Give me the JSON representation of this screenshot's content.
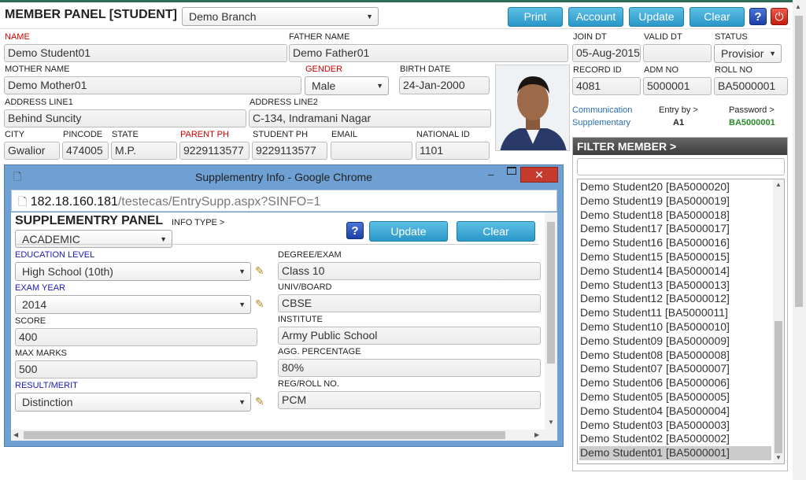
{
  "header": {
    "title": "MEMBER PANEL [STUDENT]",
    "branch": "Demo Branch",
    "buttons": [
      "Print",
      "Account",
      "Update",
      "Clear"
    ],
    "help": "?",
    "power": "⏻"
  },
  "form": {
    "name_label": "NAME",
    "name": "Demo Student01",
    "father_label": "FATHER NAME",
    "father": "Demo Father01",
    "join_label": "JOIN DT",
    "join": "05-Aug-2015",
    "valid_label": "VALID DT",
    "valid": "",
    "status_label": "STATUS",
    "status": "Provisior",
    "mother_label": "MOTHER NAME",
    "mother": "Demo Mother01",
    "gender_label": "GENDER",
    "gender": "Male",
    "birth_label": "BIRTH DATE",
    "birth": "24-Jan-2000",
    "record_label": "RECORD ID",
    "record": "4081",
    "adm_label": "ADM NO",
    "adm": "5000001",
    "roll_label": "ROLL NO",
    "roll": "BA5000001",
    "addr1_label": "ADDRESS LINE1",
    "addr1": "Behind Suncity",
    "addr2_label": "ADDRESS LINE2",
    "addr2": "C-134, Indramani Nagar",
    "comm": "Communication",
    "supp": "Supplementary",
    "entry_label": "Entry by >",
    "entry": "A1",
    "pass_label": "Password >",
    "pass": "BA5000001",
    "city_label": "CITY",
    "city": "Gwalior",
    "pin_label": "PINCODE",
    "pin": "474005",
    "state_label": "STATE",
    "state": "M.P.",
    "pph_label": "PARENT PH",
    "pph": "9229113577",
    "sph_label": "STUDENT PH",
    "sph": "9229113577",
    "email_label": "EMAIL",
    "email": "",
    "nid_label": "NATIONAL ID",
    "nid": "1101"
  },
  "popup": {
    "title": "Supplementry Info - Google Chrome",
    "url_host": "182.18.160.181",
    "url_path": "/testecas/EntrySupp.aspx?SINFO=1",
    "panel_title": "SUPPLEMENTRY PANEL",
    "info_type_label": "INFO TYPE >",
    "info_type": "ACADEMIC",
    "help": "?",
    "update": "Update",
    "clear": "Clear",
    "edu_label": "EDUCATION LEVEL",
    "edu": "High School (10th)",
    "degree_label": "DEGREE/EXAM",
    "degree": "Class 10",
    "exam_label": "EXAM YEAR",
    "exam": "2014",
    "univ_label": "UNIV/BOARD",
    "univ": "CBSE",
    "score_label": "SCORE",
    "score": "400",
    "inst_label": "INSTITUTE",
    "inst": "Army Public School",
    "max_label": "MAX MARKS",
    "max": "500",
    "agg_label": "AGG. PERCENTAGE",
    "agg": "80%",
    "result_label": "RESULT/MERIT",
    "result": "Distinction",
    "reg_label": "REG/ROLL NO.",
    "reg": "PCM"
  },
  "filter": {
    "title": "FILTER MEMBER >",
    "items": [
      "Demo Student20 [BA5000020]",
      "Demo Student19 [BA5000019]",
      "Demo Student18 [BA5000018]",
      "Demo Student17 [BA5000017]",
      "Demo Student16 [BA5000016]",
      "Demo Student15 [BA5000015]",
      "Demo Student14 [BA5000014]",
      "Demo Student13 [BA5000013]",
      "Demo Student12 [BA5000012]",
      "Demo Student11 [BA5000011]",
      "Demo Student10 [BA5000010]",
      "Demo Student09 [BA5000009]",
      "Demo Student08 [BA5000008]",
      "Demo Student07 [BA5000007]",
      "Demo Student06 [BA5000006]",
      "Demo Student05 [BA5000005]",
      "Demo Student04 [BA5000004]",
      "Demo Student03 [BA5000003]",
      "Demo Student02 [BA5000002]",
      "Demo Student01 [BA5000001]"
    ]
  },
  "colors": {
    "accent": "#2a97c8",
    "label_red": "#cc0000",
    "label_blue": "#1a1ab3",
    "window": "#6ea0d4"
  }
}
